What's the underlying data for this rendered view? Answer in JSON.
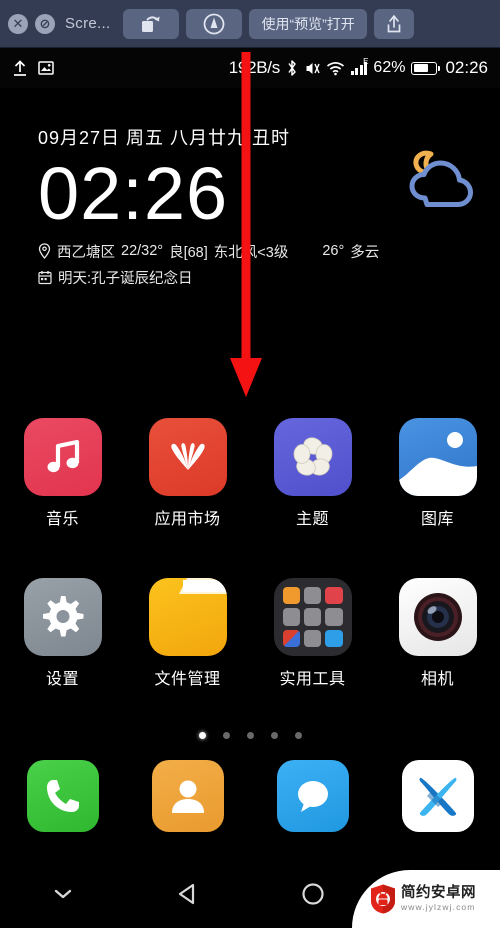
{
  "quicklook": {
    "close_label": "✕",
    "block_label": "⊘",
    "title": "Scre...",
    "rotate_label": "rotate-icon",
    "markup_label": "markup-icon",
    "open_with_label": "使用“预览”打开",
    "share_label": "share-icon"
  },
  "statusbar": {
    "upload_icon": "upload-icon",
    "screenshot_icon": "screenshot-icon",
    "net_speed": "192B/s",
    "bluetooth_icon": "bluetooth-icon",
    "mute_icon": "mute-icon",
    "wifi_icon": "wifi-icon",
    "signal_label": "E",
    "battery_pct": "62%",
    "clock": "02:26"
  },
  "widget": {
    "date": "09月27日 周五 八月廿九 丑时",
    "clock": "02:26",
    "weather_district": "西乙塘区",
    "weather_temp_range": "22/32°",
    "weather_air": "良[68]",
    "weather_wind": "东北风<3级",
    "weather_now_temp": "26°",
    "weather_now_desc": "多云",
    "festival": "明天:孔子诞辰纪念日",
    "location_icon": "location-pin-icon",
    "calendar_icon": "calendar-icon",
    "weather_icon": "night-cloudy-icon"
  },
  "apps": {
    "row1": [
      {
        "label": "音乐",
        "icon": "music-icon",
        "color": "#e8455e"
      },
      {
        "label": "应用市场",
        "icon": "huawei-appgallery-icon",
        "color": "#e2432f"
      },
      {
        "label": "主题",
        "icon": "themes-icon",
        "color": "#5a5ad4"
      },
      {
        "label": "图库",
        "icon": "gallery-icon",
        "color": "#3b82d6"
      }
    ],
    "row2": [
      {
        "label": "设置",
        "icon": "settings-gear-icon",
        "color": "#8a929b"
      },
      {
        "label": "文件管理",
        "icon": "file-manager-folder-icon",
        "color": "#f5b71d"
      },
      {
        "label": "实用工具",
        "icon": "tools-folder-icon",
        "color": "#2b2b2f"
      },
      {
        "label": "相机",
        "icon": "camera-icon",
        "color": "#f2f2f2"
      }
    ],
    "dock": [
      {
        "label": "phone",
        "icon": "phone-icon",
        "color": "#3fc33f"
      },
      {
        "label": "contacts",
        "icon": "contacts-icon",
        "color": "#efa43c"
      },
      {
        "label": "messages",
        "icon": "messages-icon",
        "color": "#32a5ef"
      },
      {
        "label": "browser",
        "icon": "x-browser-icon",
        "color": "#ffffff"
      }
    ]
  },
  "pager": {
    "count": 5,
    "active": 0
  },
  "navbar": {
    "dropdown_icon": "chevron-down-icon",
    "back_icon": "back-triangle-icon",
    "home_icon": "home-circle-icon",
    "recents_icon": "recents-square-icon"
  },
  "watermark": {
    "site_name": "简约安卓网",
    "site_url": "www.jylzwj.com",
    "logo_icon": "android-shield-logo-icon"
  },
  "annotation": {
    "arrow_icon": "red-down-arrow-icon",
    "color": "#f51212"
  }
}
